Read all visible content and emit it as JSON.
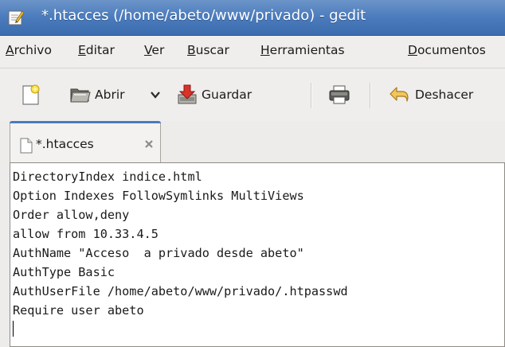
{
  "window": {
    "title": "*.htacces (/home/abeto/www/privado) - gedit"
  },
  "menubar": {
    "items": [
      {
        "pre": "",
        "key": "A",
        "post": "rchivo"
      },
      {
        "pre": "",
        "key": "E",
        "post": "ditar"
      },
      {
        "pre": "",
        "key": "V",
        "post": "er"
      },
      {
        "pre": "",
        "key": "B",
        "post": "uscar"
      },
      {
        "pre": "",
        "key": "H",
        "post": "erramientas"
      },
      {
        "pre": "",
        "key": "D",
        "post": "ocumentos"
      }
    ]
  },
  "toolbar": {
    "open_label": "Abrir",
    "save_label": "Guardar",
    "undo_label": "Deshacer"
  },
  "tab": {
    "label": "*.htacces"
  },
  "editor": {
    "lines": [
      "DirectoryIndex indice.html",
      "Option Indexes FollowSymlinks MultiViews",
      "Order allow,deny",
      "allow from 10.33.4.5",
      "AuthName \"Acceso  a privado desde abeto\"",
      "AuthType Basic",
      "AuthUserFile /home/abeto/www/privado/.htpasswd",
      "Require user abeto"
    ]
  }
}
